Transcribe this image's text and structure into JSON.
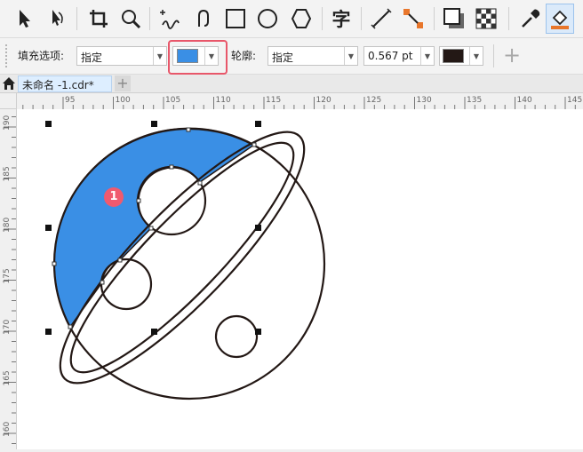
{
  "property_bar": {
    "fill_label": "填充选项:",
    "fill_type": "指定",
    "outline_label": "轮廓:",
    "outline_type": "指定",
    "outline_width": "0.567 pt",
    "fill_color": "#3a8fe5",
    "outline_color": "#231815",
    "add_symbol": "+"
  },
  "tabs": {
    "document": "未命名 -1.cdr*",
    "add": "+"
  },
  "hruler": {
    "ticks": [
      "95",
      "100",
      "105",
      "110",
      "115",
      "120",
      "125",
      "130",
      "135",
      "140",
      "145"
    ]
  },
  "vruler": {
    "ticks": [
      "190",
      "185",
      "180",
      "175",
      "170",
      "165",
      "160"
    ]
  },
  "annotation": {
    "marker": "1"
  },
  "colors": {
    "accent_blue": "#3a8fe5",
    "outline": "#231815",
    "highlight": "#e8576a",
    "badge": "#f05a6e"
  },
  "toolbar": {
    "icons": [
      "pick-tool-icon",
      "shape-tool-icon",
      "crop-tool-icon",
      "zoom-tool-icon",
      "freehand-tool-icon",
      "smart-drawing-icon",
      "rectangle-tool-icon",
      "ellipse-tool-icon",
      "polygon-tool-icon",
      "text-tool-icon",
      "dimension-tool-icon",
      "connector-tool-icon",
      "drop-shadow-icon",
      "transparency-icon",
      "eyedropper-icon",
      "smart-fill-icon"
    ],
    "text_tool_glyph": "字"
  }
}
